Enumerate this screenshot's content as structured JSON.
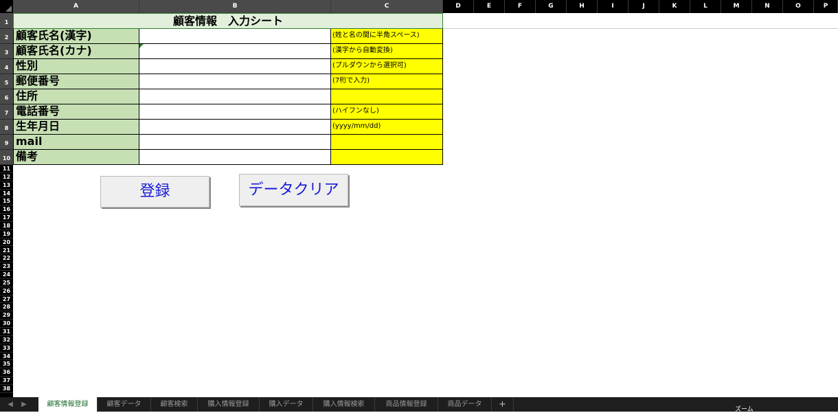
{
  "columns": [
    "A",
    "B",
    "C",
    "D",
    "E",
    "F",
    "G",
    "H",
    "I",
    "J",
    "K",
    "L",
    "M",
    "N",
    "O",
    "P"
  ],
  "rows": [
    "1",
    "2",
    "3",
    "4",
    "5",
    "6",
    "7",
    "8",
    "9",
    "10",
    "11",
    "12",
    "13",
    "14",
    "15",
    "16",
    "17",
    "18",
    "19",
    "20",
    "21",
    "22",
    "23",
    "24",
    "25",
    "26",
    "27",
    "28",
    "29",
    "30",
    "31",
    "32",
    "33",
    "34",
    "35",
    "36",
    "37",
    "38"
  ],
  "sheet": {
    "title": "顧客情報　入力シート",
    "fields": [
      {
        "label": "顧客氏名(漢字)",
        "value": "",
        "hint": "(姓と名の間に半角スペース)"
      },
      {
        "label": "顧客氏名(カナ)",
        "value": "",
        "hint": "(漢字から自動変換)"
      },
      {
        "label": "性別",
        "value": "",
        "hint": "(プルダウンから選択可)"
      },
      {
        "label": "郵便番号",
        "value": "",
        "hint": "(7桁で入力)"
      },
      {
        "label": "住所",
        "value": "",
        "hint": ""
      },
      {
        "label": "電話番号",
        "value": "",
        "hint": "(ハイフンなし)"
      },
      {
        "label": "生年月日",
        "value": "",
        "hint": "(yyyy/mm/dd)"
      },
      {
        "label": "mail",
        "value": "",
        "hint": ""
      },
      {
        "label": "備考",
        "value": "",
        "hint": ""
      }
    ]
  },
  "buttons": {
    "register": "登録",
    "clear": "データクリア"
  },
  "tabs": [
    "顧客情報登録",
    "顧客データ",
    "顧客検索",
    "購入情報登録",
    "購入データ",
    "購入情報検索",
    "商品情報登録",
    "商品データ"
  ],
  "active_tab": "顧客情報登録",
  "add_tab": "+",
  "nav": {
    "prev": "◀",
    "next": "▶"
  },
  "zoom_label": "ズーム",
  "colors": {
    "title_fill": "#e2efda",
    "label_fill": "#c6e0b4",
    "hint_fill": "#ffff00",
    "button_text": "#1a1ad8"
  }
}
